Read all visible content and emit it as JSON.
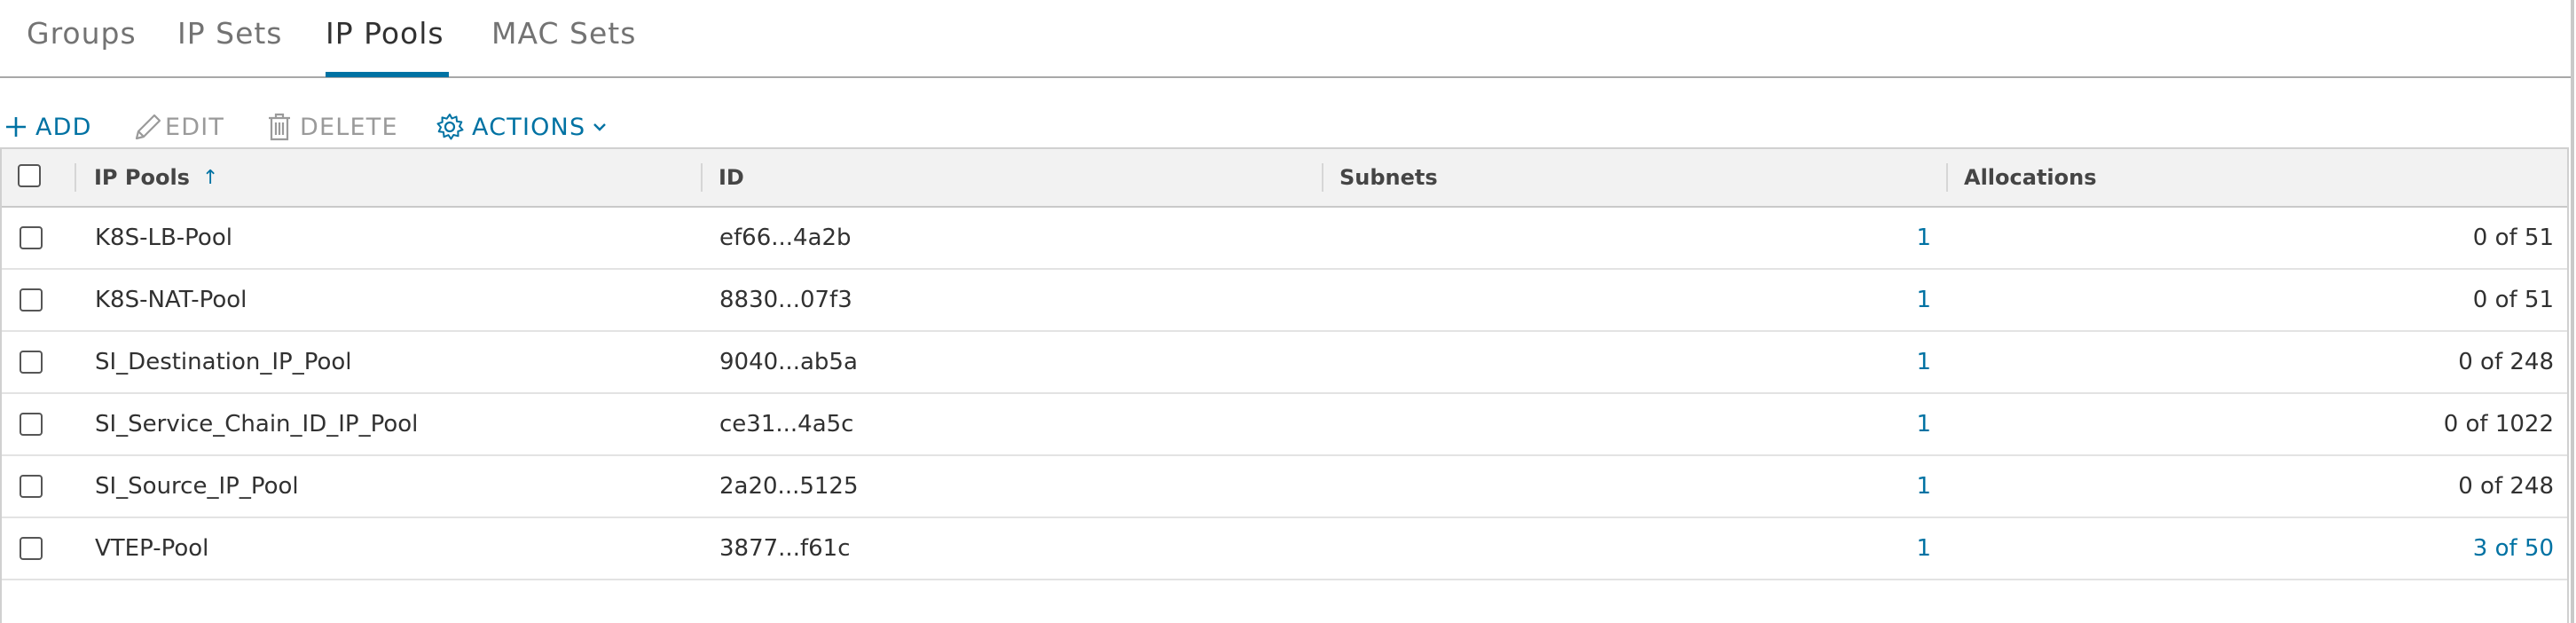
{
  "tabs": [
    {
      "label": "Groups",
      "active": false
    },
    {
      "label": "IP Sets",
      "active": false
    },
    {
      "label": "IP Pools",
      "active": true
    },
    {
      "label": "MAC Sets",
      "active": false
    }
  ],
  "toolbar": {
    "add_label": "ADD",
    "edit_label": "EDIT",
    "delete_label": "DELETE",
    "actions_label": "ACTIONS"
  },
  "grid": {
    "columns": {
      "name": "IP Pools",
      "id": "ID",
      "subnets": "Subnets",
      "allocations": "Allocations"
    },
    "sort_indicator": "↑",
    "rows": [
      {
        "name": "K8S-LB-Pool",
        "id": "ef66...4a2b",
        "subnets": "1",
        "allocations": "0 of 51"
      },
      {
        "name": "K8S-NAT-Pool",
        "id": "8830...07f3",
        "subnets": "1",
        "allocations": "0 of 51"
      },
      {
        "name": "SI_Destination_IP_Pool",
        "id": "9040...ab5a",
        "subnets": "1",
        "allocations": "0 of 248"
      },
      {
        "name": "SI_Service_Chain_ID_IP_Pool",
        "id": "ce31...4a5c",
        "subnets": "1",
        "allocations": "0 of 1022"
      },
      {
        "name": "SI_Source_IP_Pool",
        "id": "2a20...5125",
        "subnets": "1",
        "allocations": "0 of 248"
      },
      {
        "name": "VTEP-Pool",
        "id": "3877...f61c",
        "subnets": "1",
        "allocations": "3 of 50"
      }
    ]
  },
  "colors": {
    "accent": "#0072a3",
    "disabled": "#9a9a9a",
    "header_bg": "#f2f2f2"
  }
}
